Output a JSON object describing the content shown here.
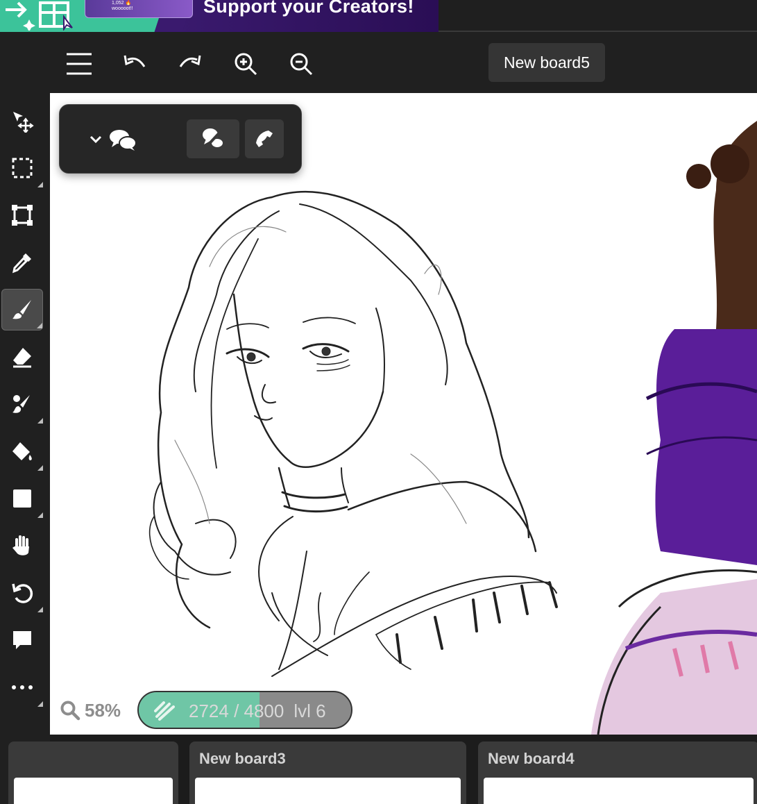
{
  "banner": {
    "headline": "Support your Creators!",
    "card_line1": "1,052 🔥",
    "card_line2": "wooooot!!",
    "colors": {
      "green": "#3cc39a",
      "purple": "#3a1a6e"
    }
  },
  "topbar": {
    "board_name": "New board5",
    "buttons": [
      "menu-icon",
      "undo-icon",
      "redo-icon",
      "zoom-in-icon",
      "zoom-out-icon"
    ]
  },
  "sidebar": {
    "tools": [
      {
        "name": "move",
        "icon": "move-arrow-icon",
        "has_submenu": false,
        "active": false
      },
      {
        "name": "select",
        "icon": "marquee-select-icon",
        "has_submenu": true,
        "active": false
      },
      {
        "name": "transform",
        "icon": "transform-icon",
        "has_submenu": false,
        "active": false
      },
      {
        "name": "eyedropper",
        "icon": "eyedropper-icon",
        "has_submenu": false,
        "active": false
      },
      {
        "name": "brush",
        "icon": "brush-icon",
        "has_submenu": true,
        "active": true
      },
      {
        "name": "eraser",
        "icon": "eraser-icon",
        "has_submenu": false,
        "active": false
      },
      {
        "name": "blend",
        "icon": "blend-brush-icon",
        "has_submenu": true,
        "active": false
      },
      {
        "name": "fill",
        "icon": "paint-bucket-icon",
        "has_submenu": true,
        "active": false
      },
      {
        "name": "shape",
        "icon": "square-shape-icon",
        "has_submenu": true,
        "active": false
      },
      {
        "name": "pan",
        "icon": "hand-icon",
        "has_submenu": false,
        "active": false
      },
      {
        "name": "rotate",
        "icon": "rotate-icon",
        "has_submenu": true,
        "active": false
      },
      {
        "name": "comment",
        "icon": "comment-icon",
        "has_submenu": false,
        "active": false
      },
      {
        "name": "more",
        "icon": "more-dots-icon",
        "has_submenu": true,
        "active": false
      }
    ]
  },
  "canvas": {
    "zoom": "58%",
    "xp": {
      "text": "2724 / 4800",
      "level": "lvl 6",
      "progress": 0.5675
    }
  },
  "boards": [
    {
      "name": ""
    },
    {
      "name": "New board3"
    },
    {
      "name": "New board4"
    }
  ]
}
